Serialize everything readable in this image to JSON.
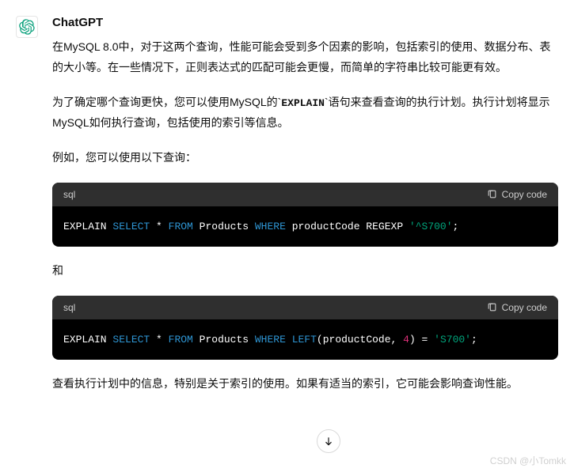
{
  "author": "ChatGPT",
  "paragraphs": {
    "p1": "在MySQL 8.0中，对于这两个查询，性能可能会受到多个因素的影响，包括索引的使用、数据分布、表的大小等。在一些情况下，正则表达式的匹配可能会更慢，而简单的字符串比较可能更有效。",
    "p2_a": "为了确定哪个查询更快，您可以使用MySQL的`",
    "p2_code": "EXPLAIN",
    "p2_b": "`语句来查看查询的执行计划。执行计划将显示MySQL如何执行查询，包括使用的索引等信息。",
    "p3": "例如，您可以使用以下查询：",
    "p4": "和",
    "p5": "查看执行计划中的信息，特别是关于索引的使用。如果有适当的索引，它可能会影响查询性能。"
  },
  "code_lang": "sql",
  "copy_label": "Copy code",
  "code1": {
    "t1": "EXPLAIN ",
    "t2": "SELECT",
    "t3": " * ",
    "t4": "FROM",
    "t5": " Products ",
    "t6": "WHERE",
    "t7": " productCode REGEXP ",
    "t8": "'^S700'",
    "t9": ";"
  },
  "code2": {
    "t1": "EXPLAIN ",
    "t2": "SELECT",
    "t3": " * ",
    "t4": "FROM",
    "t5": " Products ",
    "t6": "WHERE",
    "t7": " ",
    "t8": "LEFT",
    "t9": "(productCode, ",
    "t10": "4",
    "t11": ") = ",
    "t12": "'S700'",
    "t13": ";"
  },
  "watermark": "CSDN @小Tomkk"
}
